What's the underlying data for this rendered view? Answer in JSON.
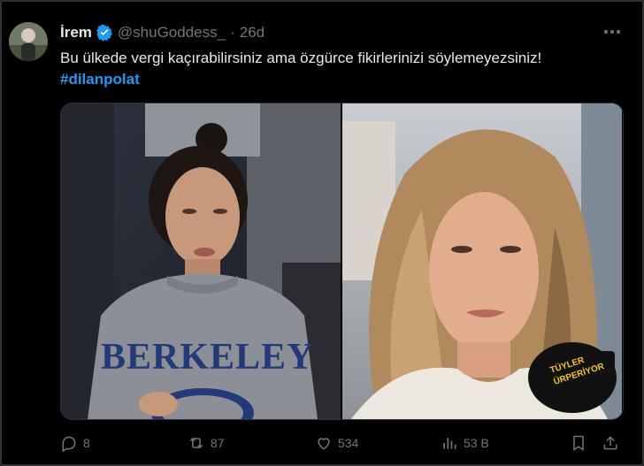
{
  "tweet": {
    "author_name": "İrem",
    "handle": "@shuGoddess_",
    "separator": "·",
    "time": "26d",
    "text": "Bu ülkede vergi kaçırabilirsiniz ama özgürce fikirlerinizi söylemeyezsiniz!",
    "hashtag": "#dilanpolat",
    "images": [
      {
        "description": "photo-woman-grey-sweatshirt",
        "overlay_text": "BERKELEY"
      },
      {
        "description": "photo-woman-interview",
        "mic_text": "TÜYLER ÜRPERİYOR"
      }
    ],
    "stats": {
      "replies": "8",
      "reposts": "87",
      "likes": "534",
      "views": "53 B"
    }
  },
  "colors": {
    "background": "#000000",
    "primary_text": "#e7e9ea",
    "secondary_text": "#71767b",
    "link": "#1d9bf0",
    "verified": "#1d9bf0"
  }
}
